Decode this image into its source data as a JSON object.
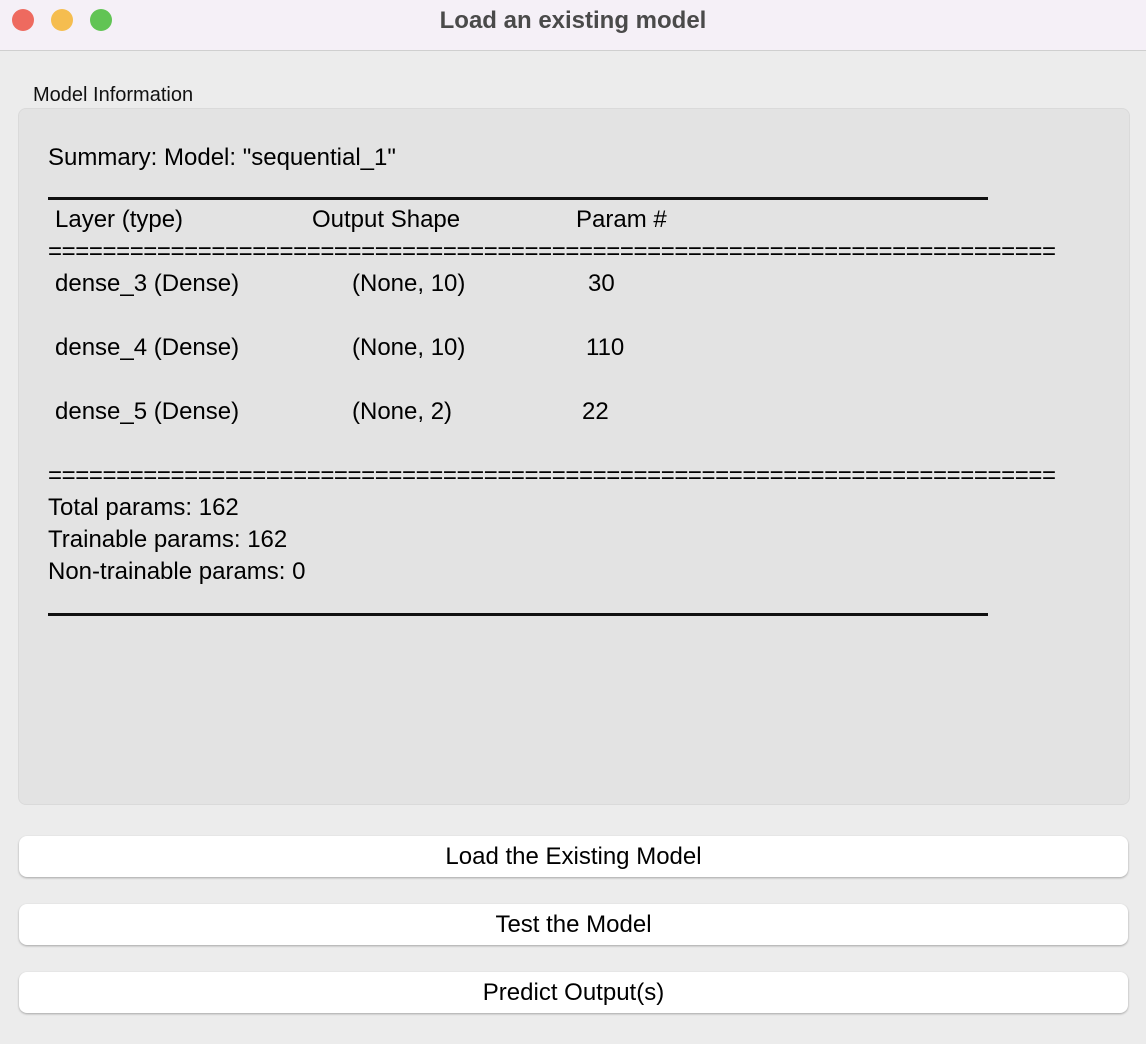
{
  "window": {
    "title": "Load an existing model",
    "controls": {
      "close_color": "#ee6a5f",
      "minimize_color": "#f5bd4f",
      "zoom_color": "#61c454"
    }
  },
  "group": {
    "label": "Model Information"
  },
  "summary": {
    "title": "Summary: Model: \"sequential_1\"",
    "headers": {
      "layer": "Layer (type)",
      "output": "Output Shape",
      "param": "Param #"
    },
    "separator": "==========================================================================",
    "rows": [
      {
        "layer": "dense_3 (Dense)",
        "output": "(None, 10)",
        "param": "30"
      },
      {
        "layer": "dense_4 (Dense)",
        "output": "(None, 10)",
        "param": "110"
      },
      {
        "layer": "dense_5 (Dense)",
        "output": "(None, 2)",
        "param": "22"
      }
    ],
    "total": "Total params: 162",
    "trainable": "Trainable params: 162",
    "non_trainable": "Non-trainable params: 0"
  },
  "buttons": {
    "load": "Load the Existing Model",
    "test": "Test the Model",
    "predict": "Predict Output(s)"
  }
}
